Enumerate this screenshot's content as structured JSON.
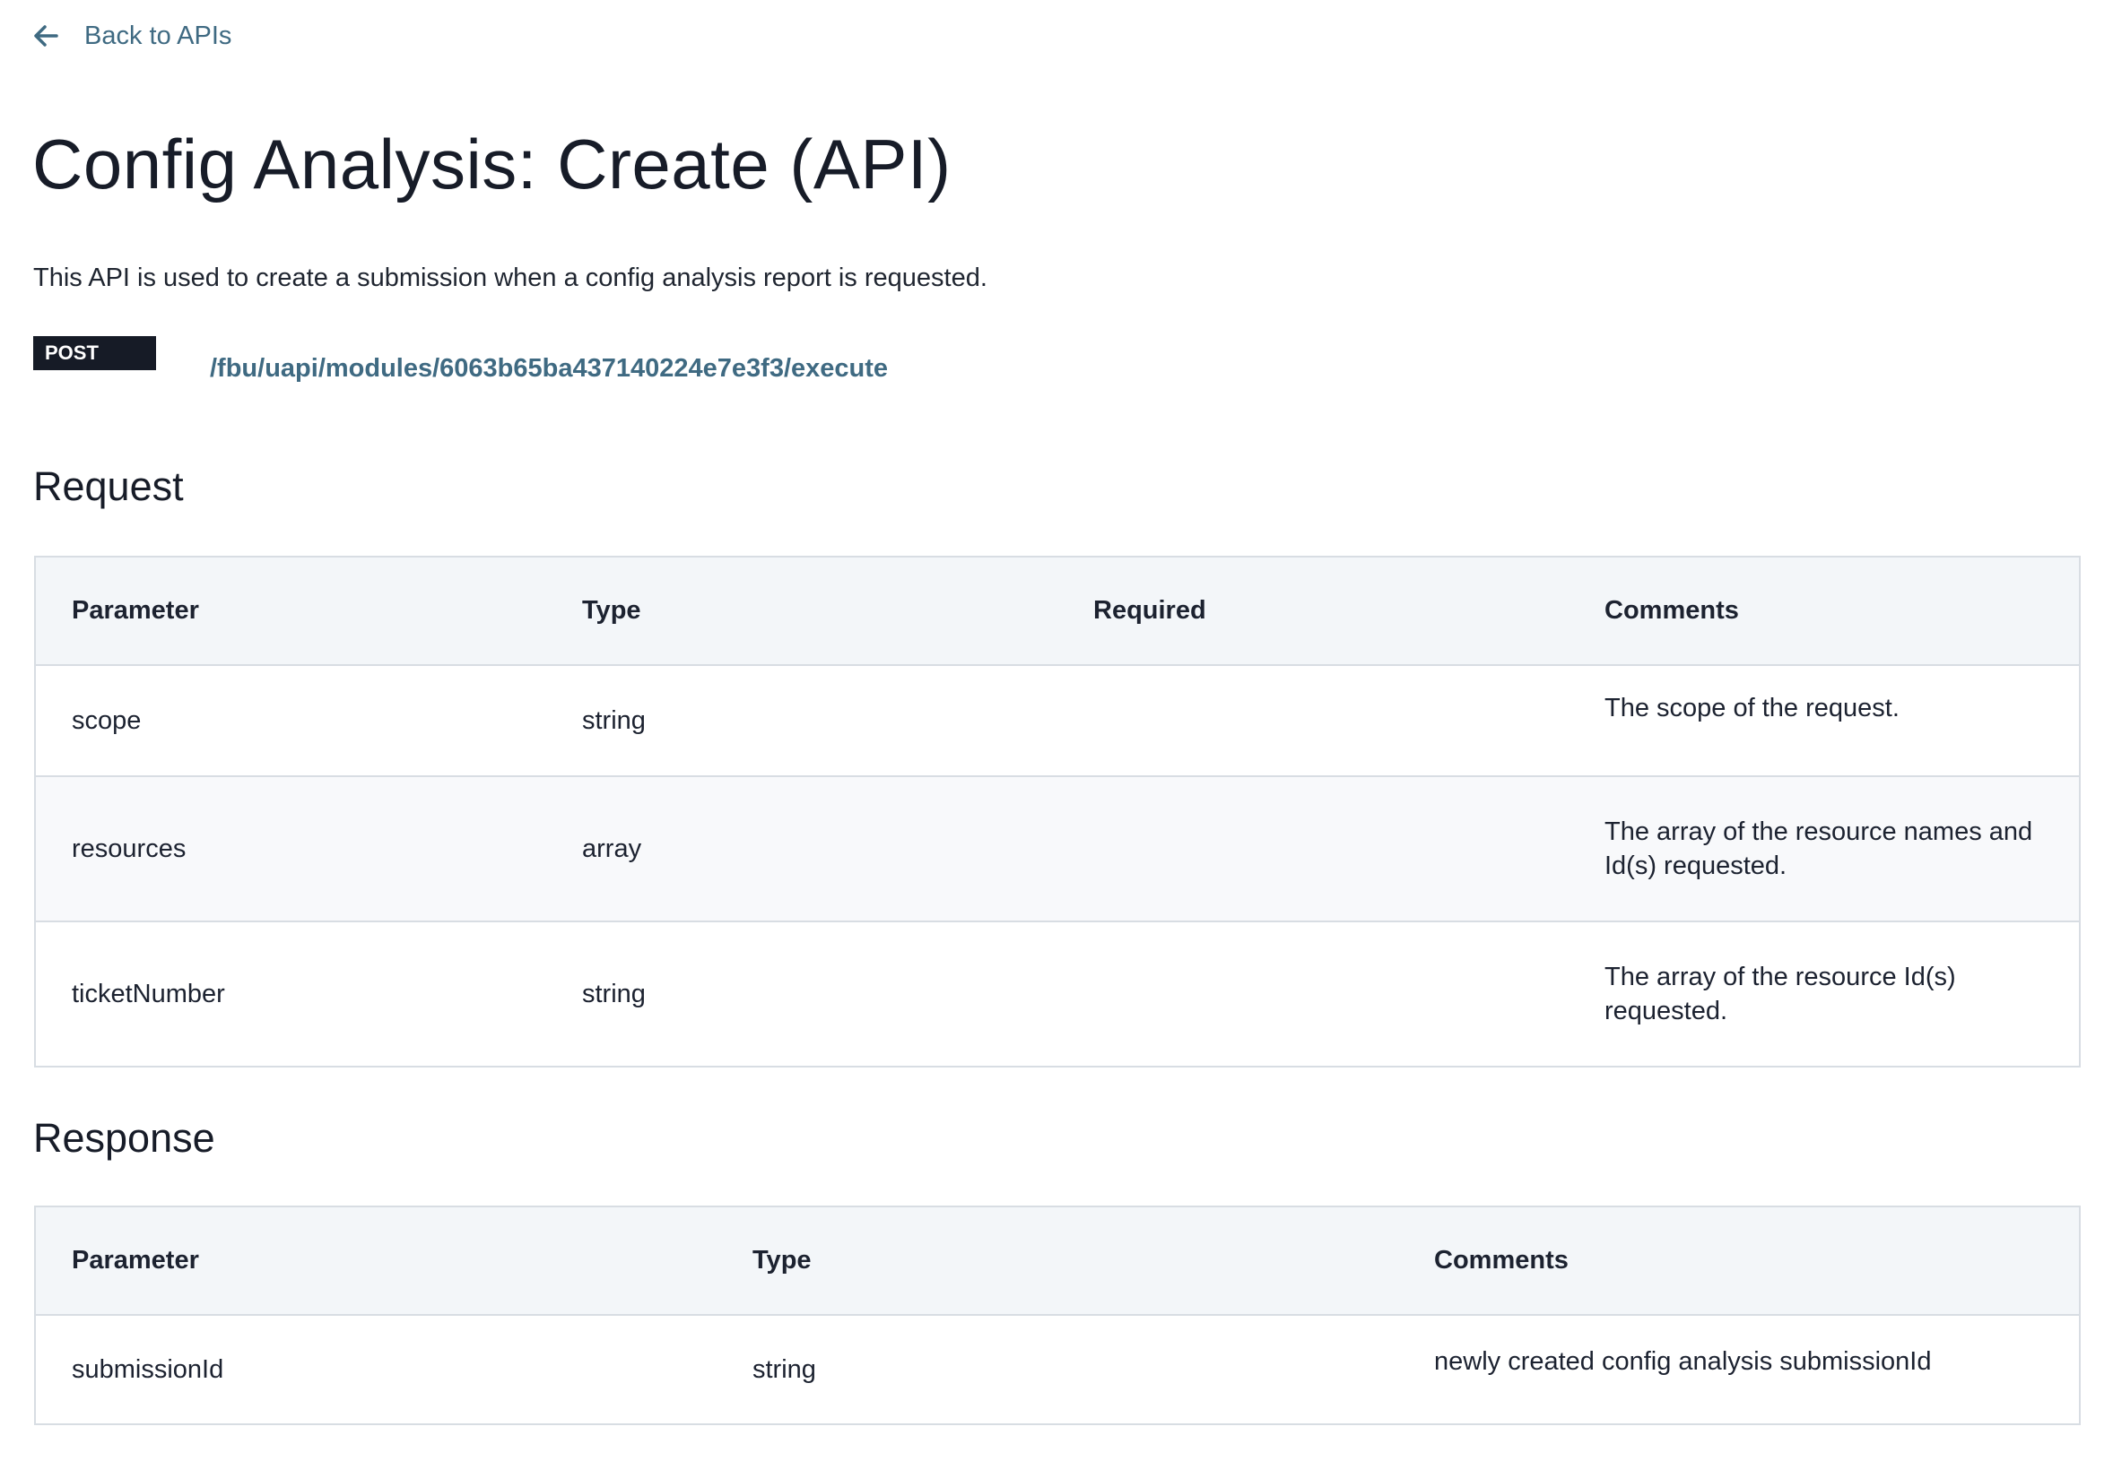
{
  "nav": {
    "back_label": "Back to APIs"
  },
  "page": {
    "title": "Config Analysis: Create (API)",
    "description": "This API is used to create a submission when a config analysis report is requested.",
    "method": "POST",
    "endpoint": "/fbu/uapi/modules/6063b65ba437140224e7e3f3/execute"
  },
  "request": {
    "title": "Request",
    "headers": [
      "Parameter",
      "Type",
      "Required",
      "Comments"
    ],
    "rows": [
      {
        "parameter": "scope",
        "type": "string",
        "required": "",
        "comments": "The scope of the request."
      },
      {
        "parameter": "resources",
        "type": "array",
        "required": "",
        "comments": "The array of the resource names and Id(s) requested."
      },
      {
        "parameter": "ticketNumber",
        "type": "string",
        "required": "",
        "comments": "The array of the resource Id(s) requested."
      }
    ]
  },
  "response": {
    "title": "Response",
    "headers": [
      "Parameter",
      "Type",
      "Comments"
    ],
    "rows": [
      {
        "parameter": "submissionId",
        "type": "string",
        "comments": "newly created config analysis submissionId"
      }
    ]
  },
  "colors": {
    "link": "#3f6a82",
    "badge_bg": "#161b26",
    "header_bg": "#f3f6f9",
    "border": "#d8dde3"
  }
}
